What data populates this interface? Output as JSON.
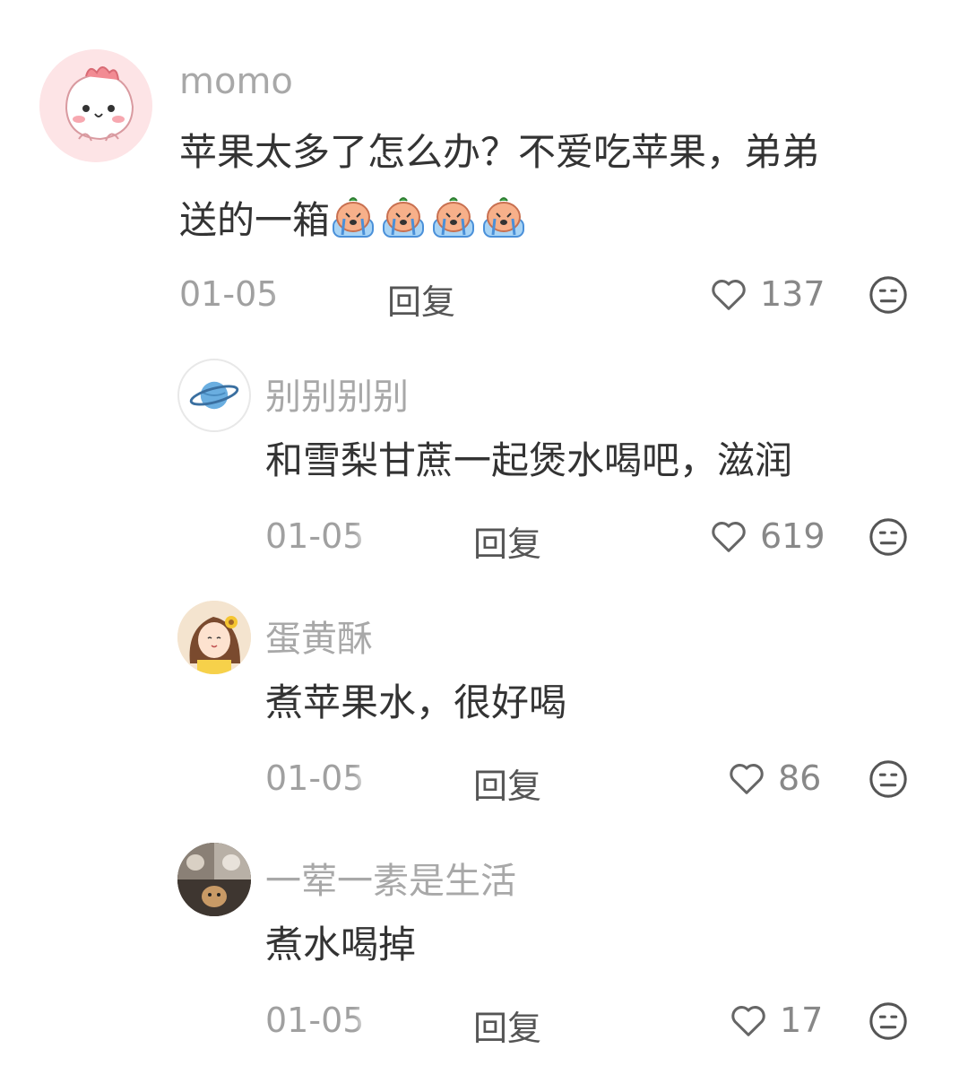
{
  "comments": [
    {
      "username": "momo",
      "text_line1": "苹果太多了怎么办？不爱吃苹果，弟弟",
      "text_line2": "送的一箱",
      "emoji": "crying-face-icon",
      "date": "01-05",
      "reply_label": "回复",
      "likes": "137"
    },
    {
      "username": "别别别别",
      "text": "和雪梨甘蔗一起煲水喝吧，滋润",
      "date": "01-05",
      "reply_label": "回复",
      "likes": "619"
    },
    {
      "username": "蛋黄酥",
      "text": "煮苹果水，很好喝",
      "date": "01-05",
      "reply_label": "回复",
      "likes": "86"
    },
    {
      "username": "一荤一素是生活",
      "text": "煮水喝掉",
      "date": "01-05",
      "reply_label": "回复",
      "likes": "17"
    }
  ],
  "colors": {
    "username": "#a8a8a8",
    "text": "#333333",
    "meta": "#a0a0a0",
    "icon": "#555555",
    "avatar_pink": "#fde4e6",
    "avatar_planet": "#6aaee0"
  },
  "icons": {
    "like": "heart-outline-icon",
    "dislike": "meh-face-icon"
  }
}
